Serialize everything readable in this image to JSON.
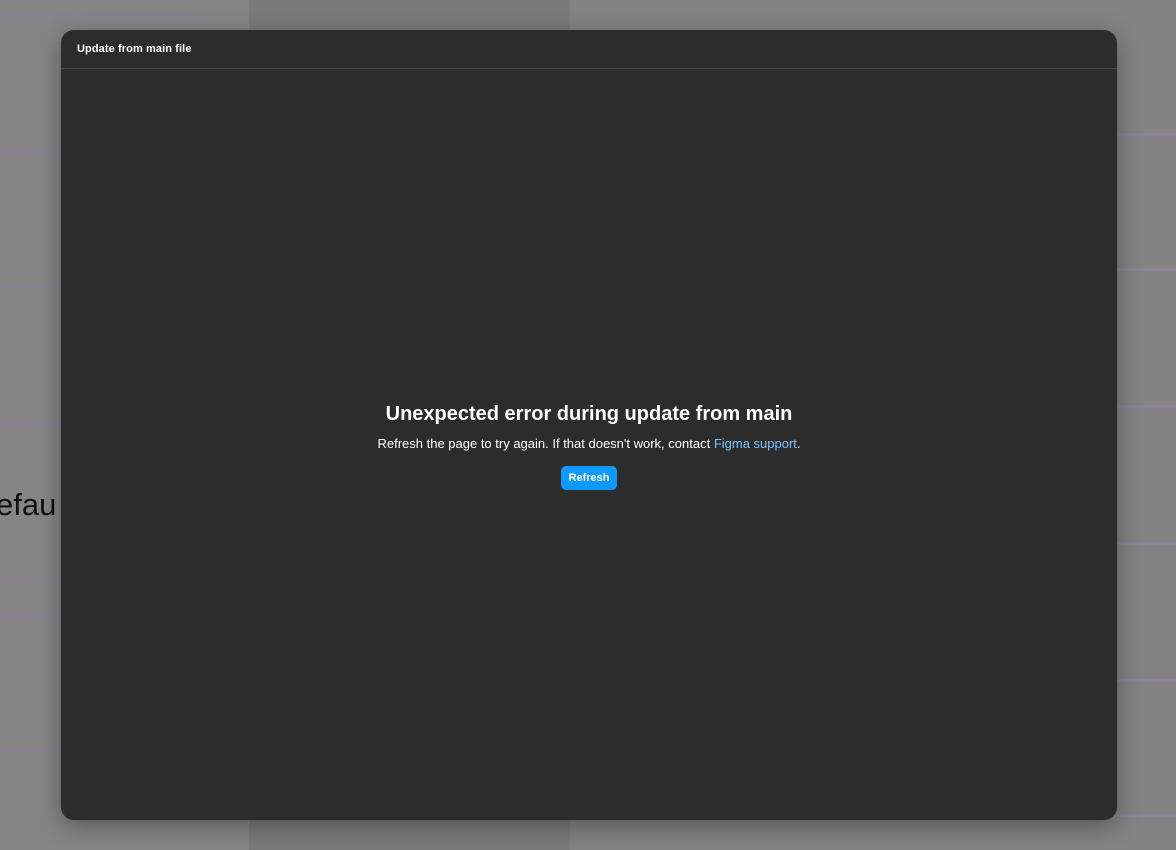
{
  "background": {
    "canvas_text": "efau"
  },
  "modal": {
    "title": "Update from main file",
    "error": {
      "heading": "Unexpected error during update from main",
      "message_prefix": "Refresh the page to try again. If that doesn't work, contact ",
      "support_link_label": "Figma support",
      "message_suffix": ".",
      "refresh_label": "Refresh"
    }
  },
  "colors": {
    "modal_background": "#2c2c2c",
    "link": "#7cc4fa",
    "primary_button": "#0d99ff",
    "overlay": "#808080"
  }
}
